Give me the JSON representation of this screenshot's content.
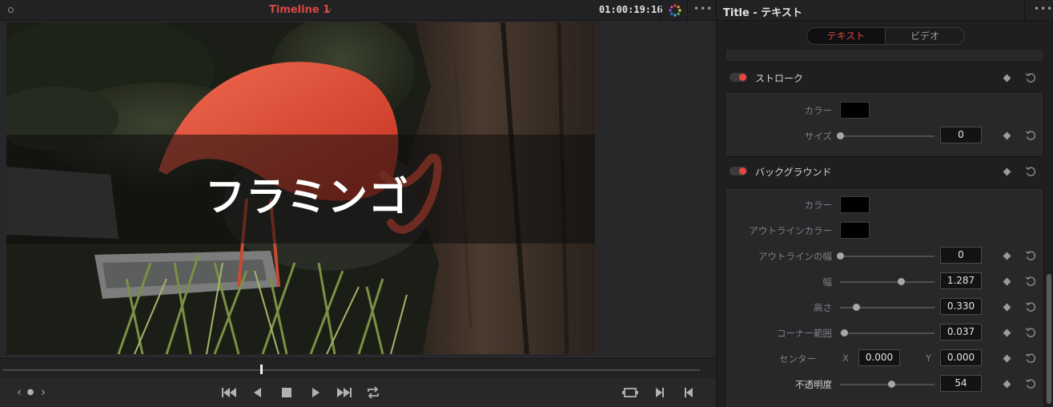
{
  "viewer": {
    "timeline_name": "Timeline 1",
    "timecode": "01:00:19:16",
    "title_text": "フラミンゴ",
    "playhead_fraction": 0.37,
    "icons": {
      "dropdown": "chevron-down-icon",
      "color": "color-wheel-icon",
      "more": "more-icon"
    }
  },
  "transport": {
    "buttons": [
      "jump-to-start",
      "reverse-play",
      "stop",
      "play",
      "jump-to-end",
      "loop"
    ],
    "right_buttons": [
      "match-frame",
      "next-clip",
      "previous-clip"
    ]
  },
  "inspector": {
    "title": "Title - テキスト",
    "tabs": [
      {
        "label": "テキスト",
        "active": true
      },
      {
        "label": "ビデオ",
        "active": false
      }
    ],
    "stroke": {
      "title": "ストローク",
      "enabled": true,
      "color_label": "カラー",
      "color_value": "#000000",
      "size_label": "サイズ",
      "size_value": "0",
      "size_fraction": 0.0
    },
    "background": {
      "title": "バックグラウンド",
      "enabled": true,
      "color_label": "カラー",
      "color_value": "#000000",
      "outline_color_label": "アウトラインカラー",
      "outline_color_value": "#000000",
      "outline_width_label": "アウトラインの幅",
      "outline_width_value": "0",
      "outline_width_fraction": 0.0,
      "width_label": "幅",
      "width_value": "1.287",
      "width_fraction": 0.64,
      "height_label": "高さ",
      "height_value": "0.330",
      "height_fraction": 0.17,
      "corner_label": "コーナー範囲",
      "corner_value": "0.037",
      "corner_fraction": 0.04,
      "center_label": "センター",
      "center_x_label": "X",
      "center_x_value": "0.000",
      "center_y_label": "Y",
      "center_y_value": "0.000",
      "opacity_label": "不透明度",
      "opacity_value": "54",
      "opacity_fraction": 0.54
    },
    "accent_color": "#e5473e"
  }
}
